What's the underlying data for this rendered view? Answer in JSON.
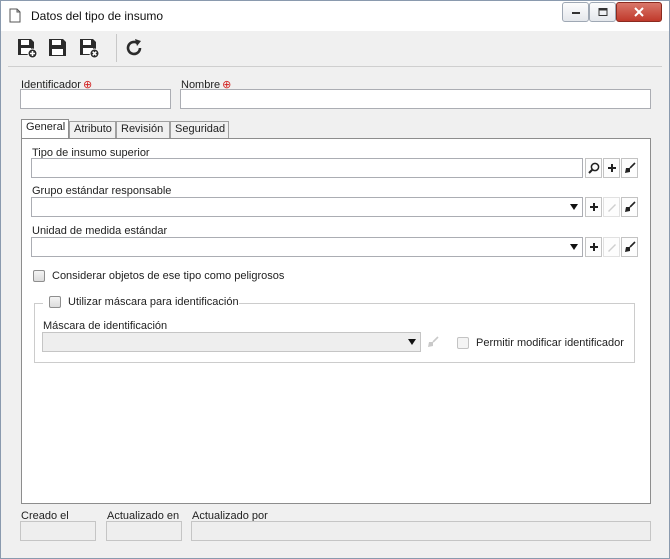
{
  "window": {
    "title": "Datos del tipo de insumo",
    "icons": {
      "document": "document-icon",
      "minimize": "minimize-icon",
      "maximize": "maximize-icon",
      "close": "close-icon"
    }
  },
  "toolbar": {
    "buttons": [
      {
        "name": "save-new-button",
        "icon": "save-new-icon"
      },
      {
        "name": "save-button",
        "icon": "save-icon"
      },
      {
        "name": "save-close-button",
        "icon": "save-close-icon"
      },
      {
        "name": "refresh-button",
        "icon": "refresh-icon"
      }
    ]
  },
  "header": {
    "identifier_label": "Identificador",
    "identifier_value": "",
    "name_label": "Nombre",
    "name_value": "",
    "required_mark": "⊕"
  },
  "tabs": [
    {
      "label": "General",
      "active": true
    },
    {
      "label": "Atributo",
      "active": false
    },
    {
      "label": "Revisión",
      "active": false
    },
    {
      "label": "Seguridad",
      "active": false
    }
  ],
  "general": {
    "superior_type_label": "Tipo de insumo superior",
    "superior_type_value": "",
    "responsible_group_label": "Grupo estándar responsable",
    "responsible_group_value": "",
    "unit_label": "Unidad de medida estándar",
    "unit_value": "",
    "dangerous_label": "Considerar objetos de ese tipo como peligrosos",
    "dangerous_checked": false,
    "mask_group_label": "Utilizar máscara para identificación",
    "mask_group_checked": false,
    "mask_label": "Máscara de identificación",
    "mask_value": "",
    "allow_modify_label": "Permitir modificar identificador",
    "allow_modify_checked": false
  },
  "footer": {
    "created_label": "Creado el",
    "created_value": "",
    "updated_label": "Actualizado en",
    "updated_value": "",
    "updated_by_label": "Actualizado por",
    "updated_by_value": ""
  },
  "colors": {
    "required": "#d21f1f",
    "toolbar_icon": "#2b2b2b",
    "disabled_icon": "#c9c9c9"
  }
}
